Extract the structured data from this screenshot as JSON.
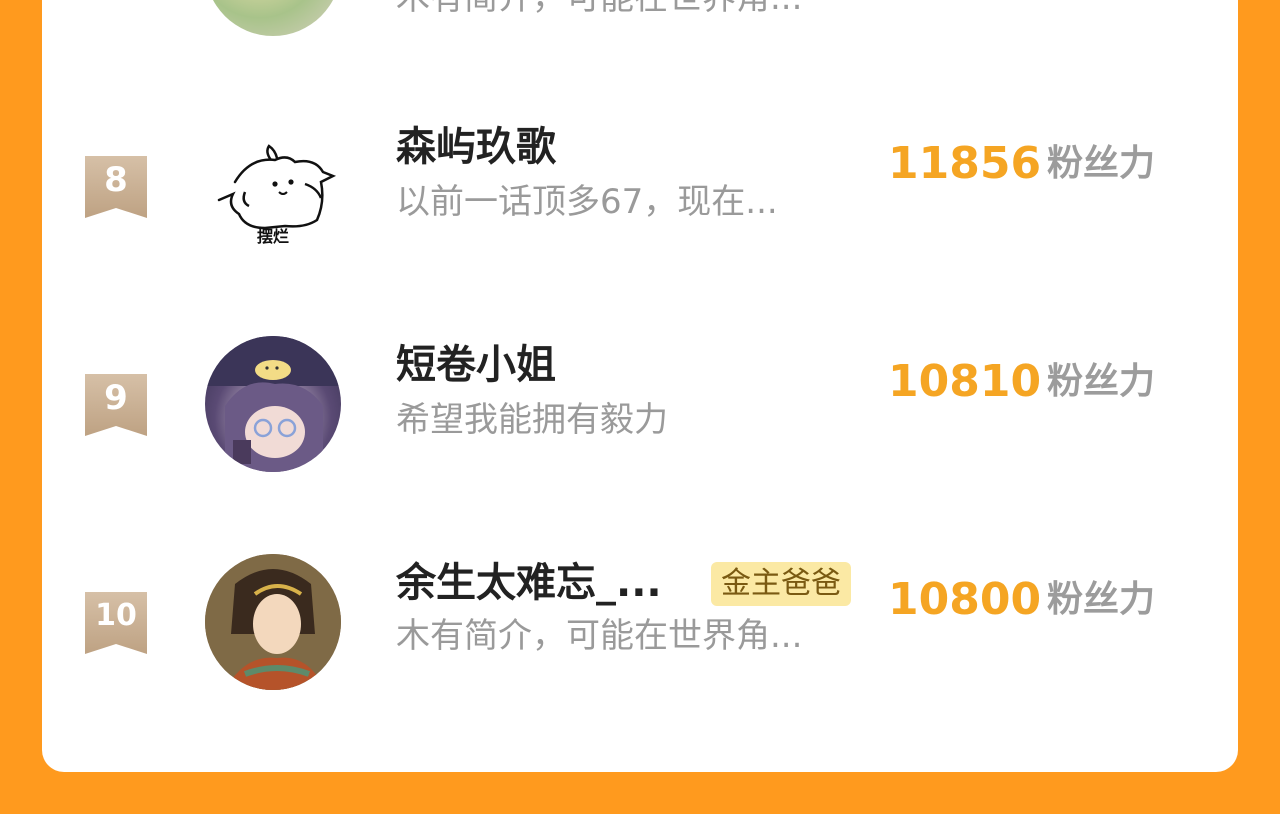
{
  "ranking": {
    "top_partial": {
      "bio": "木有简介，可能在世界角..."
    },
    "items": [
      {
        "rank": "8",
        "name": "森屿玖歌",
        "bio": "以前一话顶多67，现在...",
        "score": "11856",
        "unit": "粉丝力",
        "avatar_text": "摆烂"
      },
      {
        "rank": "9",
        "name": "短卷小姐",
        "bio": "希望我能拥有毅力",
        "score": "10810",
        "unit": "粉丝力"
      },
      {
        "rank": "10",
        "name": "余生太难忘_...",
        "tag": "金主爸爸",
        "bio": "木有简介，可能在世界角...",
        "score": "10800",
        "unit": "粉丝力"
      }
    ]
  },
  "colors": {
    "background": "#ff9a1e",
    "score": "#f5a523",
    "tag_bg": "#fbe9a4",
    "badge": "#c9ae93"
  },
  "icons": {
    "rank_badge": "ribbon-badge-icon"
  }
}
